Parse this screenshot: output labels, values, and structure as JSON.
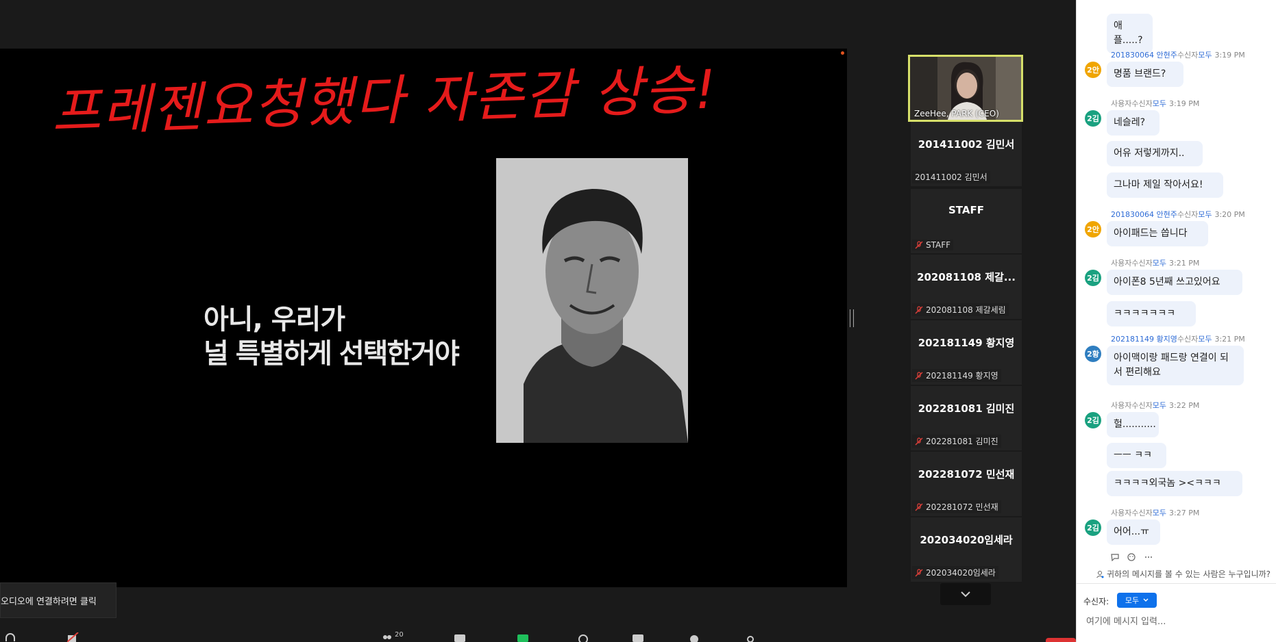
{
  "share": {
    "annotation": "프레젠요청했다  자존감 상승!",
    "caption_line1": "아니, 우리가",
    "caption_line2": "널 특별하게 선택한거야"
  },
  "video_tile": {
    "name": "ZeeHee, PARK (CEO)"
  },
  "participants": [
    {
      "name": "201411002 김민서",
      "label": "201411002 김민서",
      "muted": false
    },
    {
      "name": "STAFF",
      "label": "STAFF",
      "muted": true
    },
    {
      "name": "202081108 제갈...",
      "label": "202081108 제갈세림",
      "muted": true
    },
    {
      "name": "202181149 황지영",
      "label": "202181149 황지영",
      "muted": true
    },
    {
      "name": "202281081 김미진",
      "label": "202281081 김미진",
      "muted": true
    },
    {
      "name": "202281072 민선재",
      "label": "202281072 민선재",
      "muted": true
    },
    {
      "name": "202034020임세라",
      "label": "202034020임세라",
      "muted": true
    }
  ],
  "audio_tooltip": "오디오에 연결하려면 클릭",
  "toolbar": {
    "participants_count": "20"
  },
  "chat": {
    "recipient_label": "수신자",
    "to_word": "수신자",
    "all_word": "모두",
    "messages": [
      {
        "kind": "bubble",
        "text": "애플.....?"
      },
      {
        "kind": "head",
        "sender": "201830064 안현주",
        "time": "3:19 PM",
        "avatar": "2안",
        "avatar_color": "#f0a500"
      },
      {
        "kind": "bubble",
        "text": "명품 브랜드?"
      },
      {
        "kind": "head",
        "sender": "사용자",
        "time": "3:19 PM",
        "avatar": "2김",
        "avatar_color": "#1aa180"
      },
      {
        "kind": "bubble",
        "text": "네슬레?"
      },
      {
        "kind": "bubble",
        "text": "어유 저렇게까지.."
      },
      {
        "kind": "bubble",
        "text": "그나마 제일 작아서요!"
      },
      {
        "kind": "head",
        "sender": "201830064 안현주",
        "time": "3:20 PM",
        "avatar": "2안",
        "avatar_color": "#f0a500"
      },
      {
        "kind": "bubble",
        "text": "아이패드는 씁니다"
      },
      {
        "kind": "head",
        "sender": "사용자",
        "time": "3:21 PM",
        "avatar": "2김",
        "avatar_color": "#1aa180"
      },
      {
        "kind": "bubble",
        "text": "아이폰8 5년째 쓰고있어요"
      },
      {
        "kind": "bubble",
        "text": "ㅋㅋㅋㅋㅋㅋㅋ"
      },
      {
        "kind": "head",
        "sender": "202181149 황지영",
        "time": "3:21 PM",
        "avatar": "2황",
        "avatar_color": "#2f7ec0"
      },
      {
        "kind": "bubble",
        "text": "아이맥이랑 패드랑 연결이 되서 편리해요"
      },
      {
        "kind": "head",
        "sender": "사용자",
        "time": "3:22 PM",
        "avatar": "2김",
        "avatar_color": "#1aa180"
      },
      {
        "kind": "bubble",
        "text": "헐..........."
      },
      {
        "kind": "bubble",
        "text": "ㅡㅡ ㅋㅋ"
      },
      {
        "kind": "bubble",
        "text": "ㅋㅋㅋㅋ외국놈 ><ㅋㅋㅋ"
      },
      {
        "kind": "head",
        "sender": "사용자",
        "time": "3:27 PM",
        "avatar": "2김",
        "avatar_color": "#1aa180"
      },
      {
        "kind": "bubble",
        "text": "어어...ㅠ"
      }
    ],
    "visibility_note": "귀하의 메시지를 볼 수 있는 사람은 누구입니까?",
    "to_button": "모두",
    "input_placeholder": "여기에 메시지 입력..."
  }
}
